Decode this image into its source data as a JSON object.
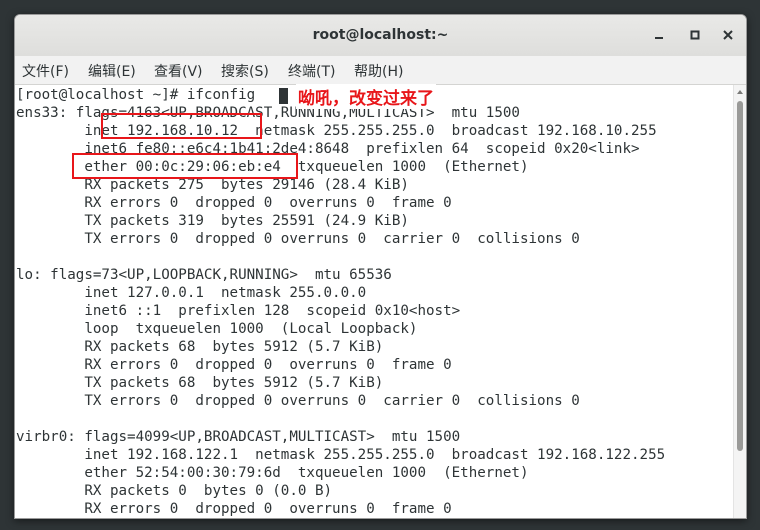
{
  "window": {
    "title": "root@localhost:~"
  },
  "menubar": {
    "items": [
      "文件(F)",
      "编辑(E)",
      "查看(V)",
      "搜索(S)",
      "终端(T)",
      "帮助(H)"
    ]
  },
  "terminal": {
    "lines": [
      "[root@localhost ~]# ifconfig",
      "ens33: flags=4163<UP,BROADCAST,RUNNING,MULTICAST>  mtu 1500",
      "        inet 192.168.10.12  netmask 255.255.255.0  broadcast 192.168.10.255",
      "        inet6 fe80::e6c4:1b41:2de4:8648  prefixlen 64  scopeid 0x20<link>",
      "        ether 00:0c:29:06:eb:e4  txqueuelen 1000  (Ethernet)",
      "        RX packets 275  bytes 29146 (28.4 KiB)",
      "        RX errors 0  dropped 0  overruns 0  frame 0",
      "        TX packets 319  bytes 25591 (24.9 KiB)",
      "        TX errors 0  dropped 0 overruns 0  carrier 0  collisions 0",
      "",
      "lo: flags=73<UP,LOOPBACK,RUNNING>  mtu 65536",
      "        inet 127.0.0.1  netmask 255.0.0.0",
      "        inet6 ::1  prefixlen 128  scopeid 0x10<host>",
      "        loop  txqueuelen 1000  (Local Loopback)",
      "        RX packets 68  bytes 5912 (5.7 KiB)",
      "        RX errors 0  dropped 0  overruns 0  frame 0",
      "        TX packets 68  bytes 5912 (5.7 KiB)",
      "        TX errors 0  dropped 0 overruns 0  carrier 0  collisions 0",
      "",
      "virbr0: flags=4099<UP,BROADCAST,MULTICAST>  mtu 1500",
      "        inet 192.168.122.1  netmask 255.255.255.0  broadcast 192.168.122.255",
      "        ether 52:54:00:30:79:6d  txqueuelen 1000  (Ethernet)",
      "        RX packets 0  bytes 0 (0.0 B)",
      "        RX errors 0  dropped 0  overruns 0  frame 0"
    ]
  },
  "annotation": {
    "text": "呦吼，改变过来了",
    "color": "#e8161a"
  },
  "icons": {
    "minimize": "minimize-icon",
    "maximize": "maximize-icon",
    "close": "close-icon"
  }
}
